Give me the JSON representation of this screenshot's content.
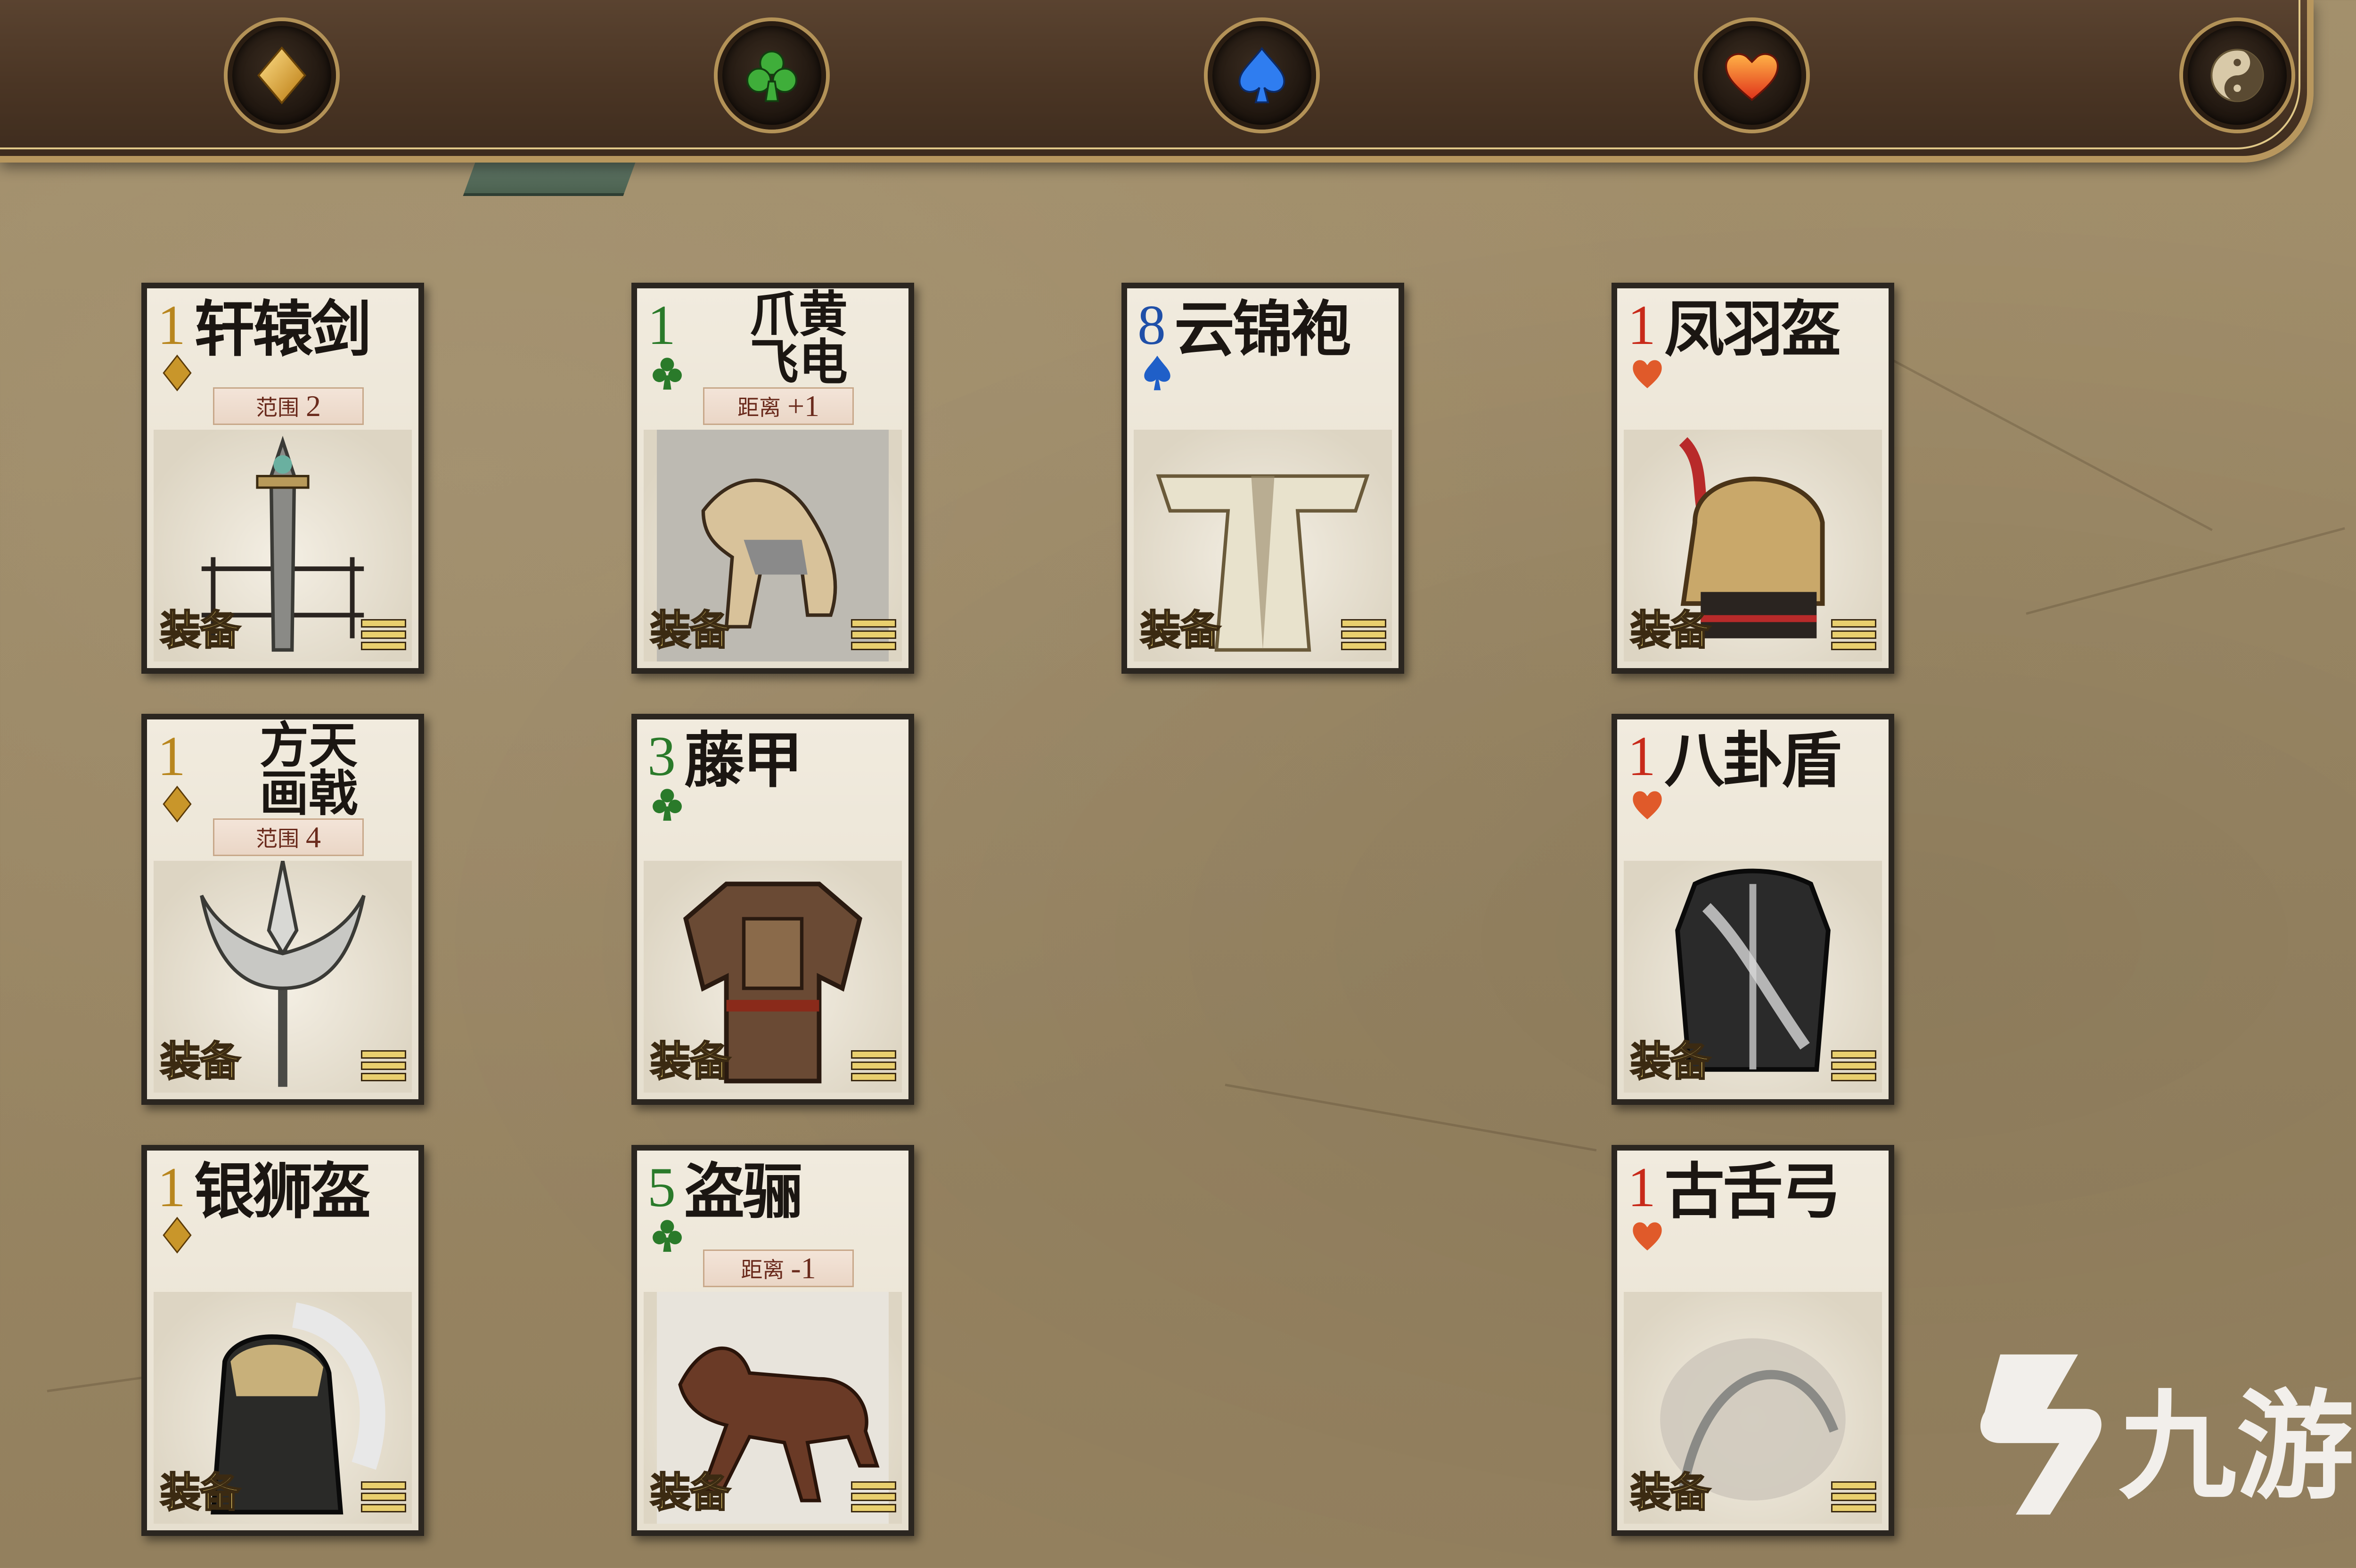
{
  "topbar": {
    "tabs": [
      {
        "icon": "diamond-icon",
        "color": "#e0a52a"
      },
      {
        "icon": "club-icon",
        "color": "#2f8a2a"
      },
      {
        "icon": "spade-icon",
        "color": "#2d6fe0"
      },
      {
        "icon": "heart-icon",
        "color": "#e84a20"
      },
      {
        "icon": "yinyang-icon",
        "color": "#c8b48c"
      }
    ]
  },
  "cards": [
    {
      "number": "1",
      "name": "轩辕剑",
      "suit": "diamond",
      "range_label": "范围",
      "range_value": "2",
      "tag": "装备",
      "art": "sword"
    },
    {
      "number": "1",
      "name": "爪黄\n飞电",
      "suit": "club",
      "range_label": "距离",
      "range_value": "+1",
      "tag": "装备",
      "art": "horse-white"
    },
    {
      "number": "8",
      "name": "云锦袍",
      "suit": "spade",
      "tag": "装备",
      "art": "robe"
    },
    {
      "number": "1",
      "name": "凤羽盔",
      "suit": "heart",
      "tag": "装备",
      "art": "helmet"
    },
    {
      "number": "1",
      "name": "方天\n画戟",
      "suit": "diamond",
      "range_label": "范围",
      "range_value": "4",
      "tag": "装备",
      "art": "halberd"
    },
    {
      "number": "3",
      "name": "藤甲",
      "suit": "club",
      "tag": "装备",
      "art": "armor"
    },
    {
      "number": "1",
      "name": "八卦盾",
      "suit": "heart",
      "tag": "装备",
      "art": "shield"
    },
    {
      "number": "1",
      "name": "银狮盔",
      "suit": "diamond",
      "tag": "装备",
      "art": "lion-helmet"
    },
    {
      "number": "5",
      "name": "盗骊",
      "suit": "club",
      "range_label": "距离",
      "range_value": "-1",
      "tag": "装备",
      "art": "horse-brown"
    },
    {
      "number": "1",
      "name": "古舌弓",
      "suit": "heart",
      "tag": "装备",
      "art": "bow"
    }
  ],
  "suit_colors": {
    "diamond": "#c9962a",
    "club": "#2a7a2a",
    "spade": "#1f5fc8",
    "heart": "#e05a2a"
  },
  "number_colors": {
    "diamond": "#b8861e",
    "club": "#2a7a2a",
    "spade": "#1f4fa8",
    "heart": "#c82a1a"
  },
  "watermark": {
    "text": "九游"
  }
}
